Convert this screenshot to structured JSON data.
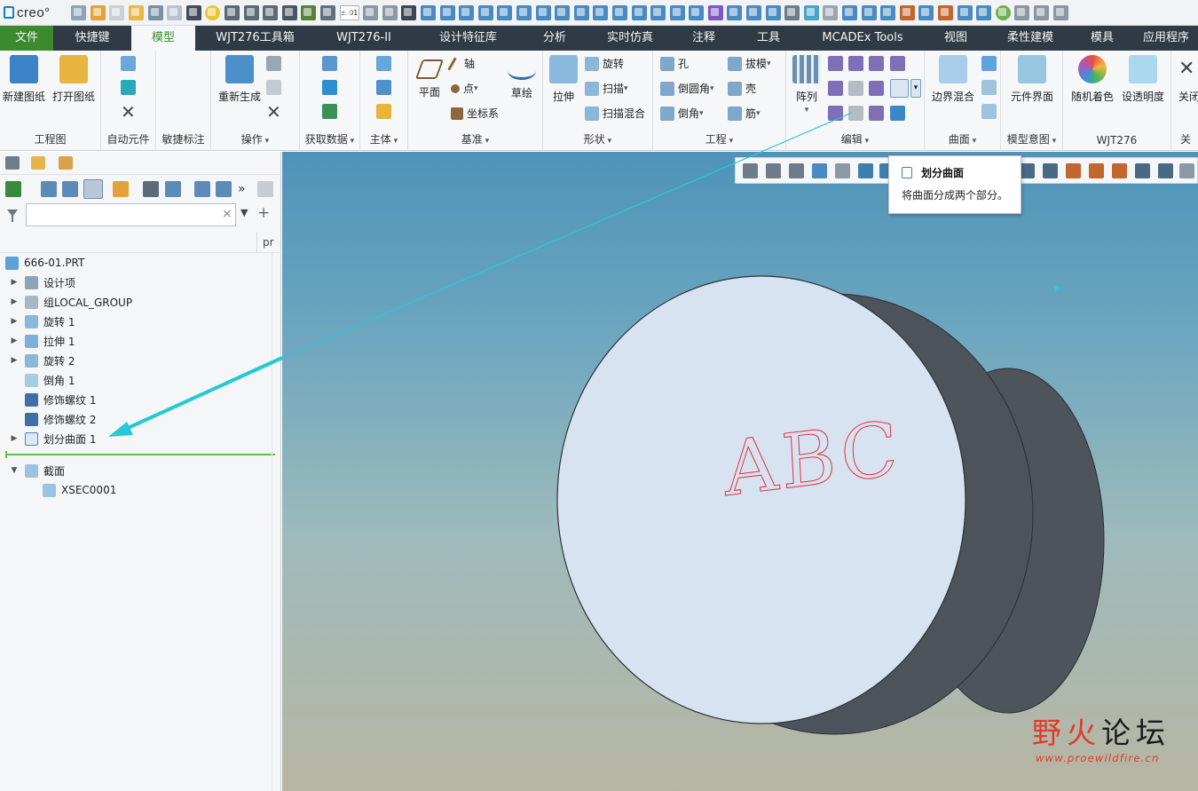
{
  "app": {
    "logo_text": "creo°"
  },
  "quick_access": {
    "tolerance_label": "±.01",
    "icons": [
      "new-icon",
      "open-icon",
      "save-icon",
      "smile-icon",
      "regen-icon",
      "window-icon",
      "close-window-icon",
      "regenerate-icon",
      "undo-icon",
      "redo-icon",
      "datum-icon",
      "sketch-icon",
      "dimension-icon",
      "measure-icon",
      "surface-icon",
      "pattern-icon",
      "curve-icon",
      "color-icon",
      "layer-icon",
      "table-icon",
      "render-icon",
      "scene-icon",
      "appearance-icon",
      "display-icon",
      "settings-icon",
      "help-icon"
    ]
  },
  "tabs": [
    {
      "label": "文件"
    },
    {
      "label": "快捷键"
    },
    {
      "label": "模型"
    },
    {
      "label": "WJT276工具箱"
    },
    {
      "label": "WJT276-II"
    },
    {
      "label": "设计特征库"
    },
    {
      "label": "分析"
    },
    {
      "label": "实时仿真"
    },
    {
      "label": "注释"
    },
    {
      "label": "工具"
    },
    {
      "label": "MCADEx Tools"
    },
    {
      "label": "视图"
    },
    {
      "label": "柔性建模"
    },
    {
      "label": "模具"
    },
    {
      "label": "应用程序"
    }
  ],
  "ribbon": {
    "groups": {
      "drawing": "工程图",
      "auto_component": "自动元件",
      "quick_annotate": "敏捷标注",
      "operations": "操作",
      "get_data": "获取数据",
      "body": "主体",
      "datum": "基准",
      "shapes": "形状",
      "engineering": "工程",
      "editing": "编辑",
      "surfaces": "曲面",
      "model_intent": "模型意图",
      "wjt276": "WJT276",
      "relations_cut": "关"
    },
    "buttons": {
      "new_drawing": "新建图纸",
      "open_drawing": "打开图纸",
      "regenerate": "重新生成",
      "plane": "平面",
      "axis": "轴",
      "point": "点",
      "csys": "坐标系",
      "sketch": "草绘",
      "extrude": "拉伸",
      "revolve": "旋转",
      "sweep": "扫描",
      "swept_blend": "扫描混合",
      "hole": "孔",
      "round": "倒圆角",
      "chamfer": "倒角",
      "draft": "拔模",
      "shell": "壳",
      "rib": "筋",
      "pattern": "阵列",
      "boundary_blend": "边界混合",
      "component_interface": "元件界面",
      "random_color": "随机着色",
      "set_transparency": "设透明度",
      "close": "关闭"
    }
  },
  "model_tree": {
    "search": {
      "placeholder": "",
      "value": ""
    },
    "column_header": "pr",
    "items": [
      {
        "label": "666-01.PRT",
        "icon": "part-icon",
        "expandable": false
      },
      {
        "label": "设计项",
        "icon": "design-items-icon",
        "expandable": true
      },
      {
        "label": "组LOCAL_GROUP",
        "icon": "group-icon",
        "expandable": true
      },
      {
        "label": "旋转 1",
        "icon": "revolve-icon",
        "expandable": true
      },
      {
        "label": "拉伸 1",
        "icon": "extrude-icon",
        "expandable": true
      },
      {
        "label": "旋转 2",
        "icon": "revolve-icon",
        "expandable": true
      },
      {
        "label": "倒角 1",
        "icon": "chamfer-icon",
        "expandable": false
      },
      {
        "label": "修饰螺纹 1",
        "icon": "cosmetic-thread-icon",
        "expandable": false
      },
      {
        "label": "修饰螺纹 2",
        "icon": "cosmetic-thread-icon",
        "expandable": false
      },
      {
        "label": "划分曲面 1",
        "icon": "split-surface-icon",
        "expandable": true
      }
    ],
    "sections": {
      "label": "截面",
      "child": "XSEC0001"
    }
  },
  "tooltip": {
    "title": "划分曲面",
    "description": "将曲面分成两个部分。"
  },
  "model": {
    "engraved_text": "ABC",
    "text_color": "#e0303f",
    "face_color": "#d8e3f2",
    "side_color": "#4c535b"
  },
  "watermark": {
    "text_red": "野火",
    "text_black": "论坛",
    "url": "www.proewildfire.cn"
  },
  "colors": {
    "accent_green": "#3b8c2f",
    "tab_bar": "#303a44",
    "callout_cyan": "#25c9d6"
  }
}
